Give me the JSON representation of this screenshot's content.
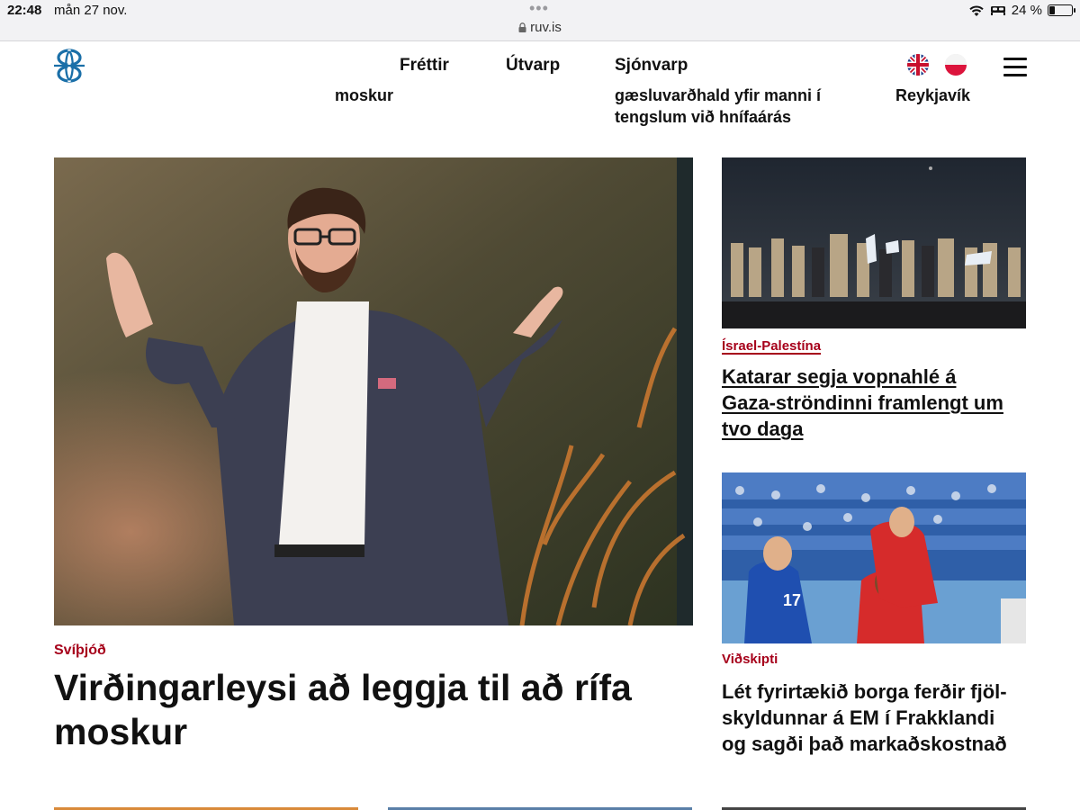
{
  "status_bar": {
    "time": "22:48",
    "date": "mån 27 nov.",
    "battery_text": "24 %",
    "battery_level": 0.24
  },
  "browser": {
    "url": "ruv.is"
  },
  "nav": {
    "items": [
      "Fréttir",
      "Útvarp",
      "Sjónvarp"
    ]
  },
  "ticker": {
    "item1": "moskur",
    "item2_line1": "gæsluvarðhald yfir manni í",
    "item2_line2": "tengslum við hnífaárás",
    "item3": "Reykjavík"
  },
  "main_article": {
    "kicker": "Svíþjóð",
    "title_line1": "Virðingarleysi að leggja til að rífa",
    "title_line2": "moskur"
  },
  "side_articles": [
    {
      "kicker": "Ísrael-Palestína",
      "title_line1": "Katarar segja vopnahlé á",
      "title_line2": "Gaza-ströndinni framlengt um",
      "title_line3": "tvo daga"
    },
    {
      "kicker": "Viðskipti",
      "title_line1": "Lét fyrirtækið borga ferðir fjöl-",
      "title_line2": "skyldunnar á EM í Frakklandi",
      "title_line3": "og sagði það markaðskostnað"
    }
  ],
  "colors": {
    "accent": "#a6001a",
    "logo": "#1a6fa8",
    "text": "#111111"
  },
  "icons": [
    "wifi-icon",
    "bed-icon",
    "battery-icon",
    "lock-icon",
    "ruv-logo",
    "uk-flag-icon",
    "poland-flag-icon",
    "menu-icon"
  ]
}
